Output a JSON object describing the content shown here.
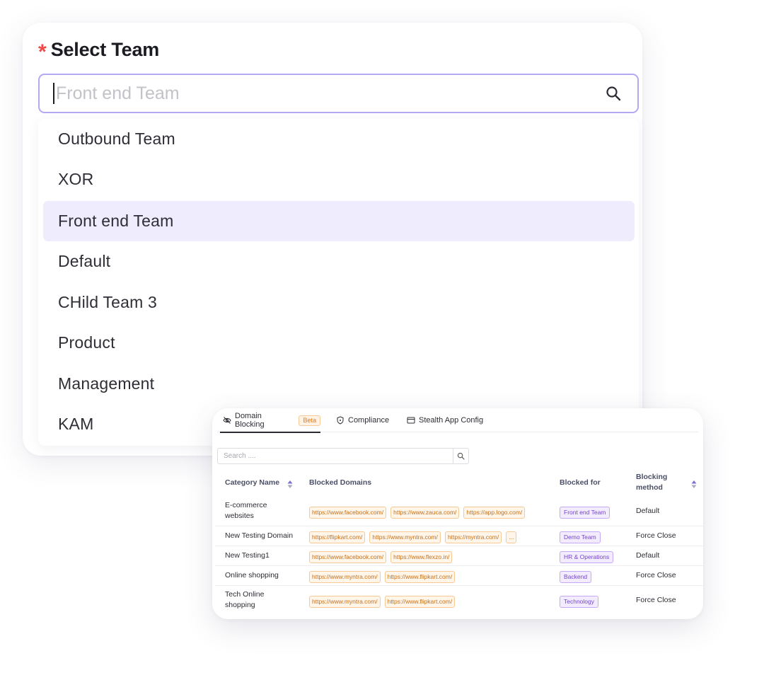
{
  "team_selector": {
    "label": "Select Team",
    "required_marker": "*",
    "search_placeholder": "Front end Team",
    "options": [
      "Outbound Team",
      "XOR",
      "Front end Team",
      "Default",
      "CHild Team 3",
      "Product",
      "Management",
      "KAM"
    ],
    "selected_option": "Front end Team",
    "accent_color": "#b6a7f3",
    "selected_bg": "#efecfd"
  },
  "settings_panel": {
    "tabs": [
      {
        "label": "Domain Blocking",
        "icon": "eye-off-icon",
        "badge": "Beta",
        "active": true
      },
      {
        "label": "Compliance",
        "icon": "shield-icon",
        "active": false
      },
      {
        "label": "Stealth App Config",
        "icon": "window-icon",
        "active": false
      }
    ],
    "search_placeholder": "Search ....",
    "table": {
      "headers": {
        "category": "Category Name",
        "domains": "Blocked Domains",
        "blocked_for": "Blocked for",
        "method_line1": "Blocking",
        "method_line2": "method"
      },
      "rows": [
        {
          "category_line1": "E-commerce",
          "category_line2": "websites",
          "domains": [
            "https://www.facebook.com/",
            "https://www.zauca.com/",
            "https://app.logo.com/"
          ],
          "blocked_for": "Front end Team",
          "method": "Default"
        },
        {
          "category_line1": "New Testing Domain",
          "category_line2": "",
          "domains": [
            "https://flipkart.com/",
            "https://www.myntra.com/",
            "https://myntra.com/",
            "..."
          ],
          "blocked_for": "Demo Team",
          "method": "Force Close"
        },
        {
          "category_line1": "New Testing1",
          "category_line2": "",
          "domains": [
            "https://www.facebook.com/",
            "https://www.flexzo.in/"
          ],
          "blocked_for": "HR & Operations",
          "method": "Default"
        },
        {
          "category_line1": "Online shopping",
          "category_line2": "",
          "domains": [
            "https://www.myntra.com/",
            "https://www.flipkart.com/"
          ],
          "blocked_for": "Backend",
          "method": "Force Close"
        },
        {
          "category_line1": "Tech Online",
          "category_line2": "shopping",
          "domains": [
            "https://www.myntra.com/",
            "https://www.flipkart.com/"
          ],
          "blocked_for": "Technology",
          "method": "Force Close"
        }
      ]
    }
  }
}
